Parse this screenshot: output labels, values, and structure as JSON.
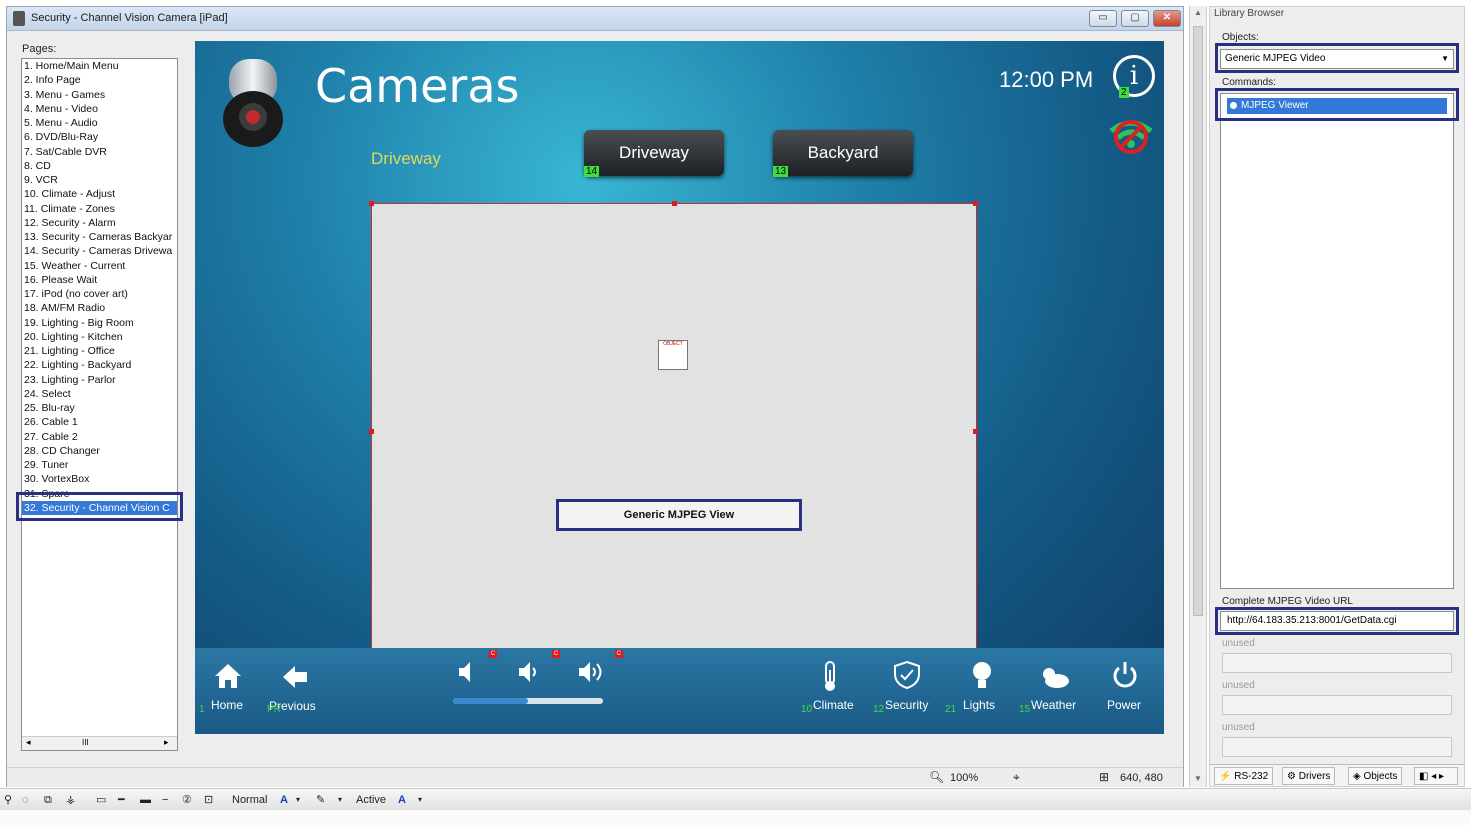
{
  "window": {
    "title": "Security - Channel Vision Camera [iPad]",
    "btn_min": "▭",
    "btn_max": "▢",
    "btn_close": "✕"
  },
  "pages": {
    "label": "Pages:",
    "items": [
      "1. Home/Main Menu",
      "2. Info Page",
      "3. Menu - Games",
      "4. Menu - Video",
      "5. Menu - Audio",
      "6. DVD/Blu-Ray",
      "7. Sat/Cable DVR",
      "8. CD",
      "9. VCR",
      "10. Climate - Adjust",
      "11. Climate - Zones",
      "12. Security - Alarm",
      "13. Security - Cameras Backyar",
      "14. Security - Cameras Drivewa",
      "15. Weather - Current",
      "16. Please Wait",
      "17. iPod (no cover art)",
      "18. AM/FM Radio",
      "19. Lighting - Big Room",
      "20. Lighting - Kitchen",
      "21. Lighting - Office",
      "22. Lighting - Backyard",
      "23. Lighting - Parlor",
      "24. Select",
      "25. Blu-ray",
      "26. Cable 1",
      "27. Cable 2",
      "28. CD Changer",
      "29. Tuner",
      "30. VortexBox",
      "31. Spare",
      "32. Security - Channel Vision C"
    ],
    "selected_index": 31,
    "scroll_thumb": "III"
  },
  "canvas": {
    "title": "Cameras",
    "subtitle": "Driveway",
    "clock": "12:00 PM",
    "info_glyph": "i",
    "info_badge": "2",
    "buttons": [
      {
        "label": "Driveway",
        "badge": "14"
      },
      {
        "label": "Backyard",
        "badge": "13"
      }
    ],
    "viewer_label": "Generic MJPEG View",
    "object_icon_text": "OBJECT",
    "toolbar": {
      "home": {
        "label": "Home",
        "badge": "1"
      },
      "previous": {
        "label": "Previous",
        "badge": "PR"
      },
      "climate": {
        "label": "Climate",
        "badge": "10"
      },
      "security": {
        "label": "Security",
        "badge": "12"
      },
      "lights": {
        "label": "Lights",
        "badge": "21"
      },
      "weather": {
        "label": "Weather",
        "badge": "15"
      },
      "power": {
        "label": "Power"
      },
      "volume_level": 0.5,
      "red_mark": "C"
    }
  },
  "statusbar": {
    "zoom": "100%",
    "size": "640, 480"
  },
  "library": {
    "header": "Library Browser",
    "objects_label": "Objects:",
    "objects_value": "Generic MJPEG Video",
    "commands_label": "Commands:",
    "command_item": "MJPEG Viewer",
    "url_label": "Complete MJPEG Video URL",
    "url_value": "http://64.183.35.213:8001/GetData.cgi",
    "unused_label": "unused",
    "tabs": [
      "RS-232",
      "Drivers",
      "Objects"
    ]
  },
  "apptool": {
    "style1": "Normal",
    "style2": "Active",
    "font_glyph": "A"
  }
}
